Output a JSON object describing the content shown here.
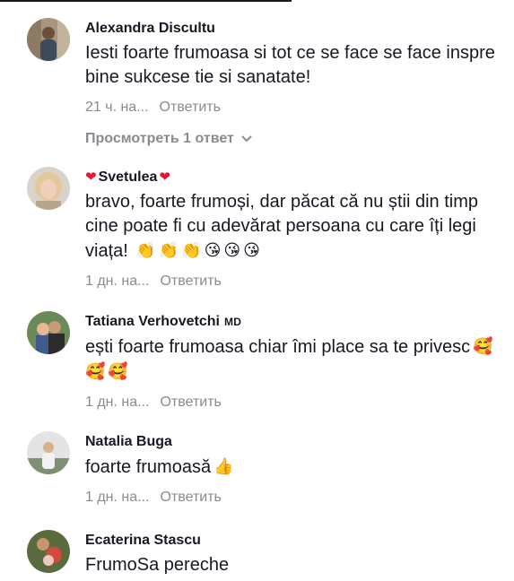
{
  "comments": [
    {
      "author": "Alexandra Discultu",
      "text": "Iesti foarte frumoasa si tot ce se face se face inspre bine sukcese tie si sanatate!",
      "time": "21 ч. на...",
      "reply_label": "Ответить",
      "view_replies": "Просмотреть 1 ответ"
    },
    {
      "author": "Svetulea",
      "name_prefix": "❤",
      "name_suffix": "❤",
      "text": "bravo, foarte frumoși, dar păcat că nu știi din timp cine poate fi cu adevărat persoana cu care îți legi viața!",
      "emojis": [
        "👏",
        "👏",
        "👏",
        "😘",
        "😘",
        "😘"
      ],
      "time": "1 дн. на...",
      "reply_label": "Ответить"
    },
    {
      "author": "Tatiana Verhovetchi",
      "badge": "MD",
      "text": "ești foarte frumoasa chiar îmi place sa te privesc",
      "emojis": [
        "🥰",
        "🥰",
        "🥰"
      ],
      "time": "1 дн. на...",
      "reply_label": "Ответить"
    },
    {
      "author": "Natalia Buga",
      "text": "foarte frumoasă",
      "emojis": [
        "👍"
      ],
      "time": "1 дн. на...",
      "reply_label": "Ответить"
    },
    {
      "author": "Ecaterina Stascu",
      "text": "FrumoSa pereche"
    }
  ],
  "colors": {
    "text": "#161823",
    "meta": "#8a8b91",
    "heart": "#e8132e"
  }
}
